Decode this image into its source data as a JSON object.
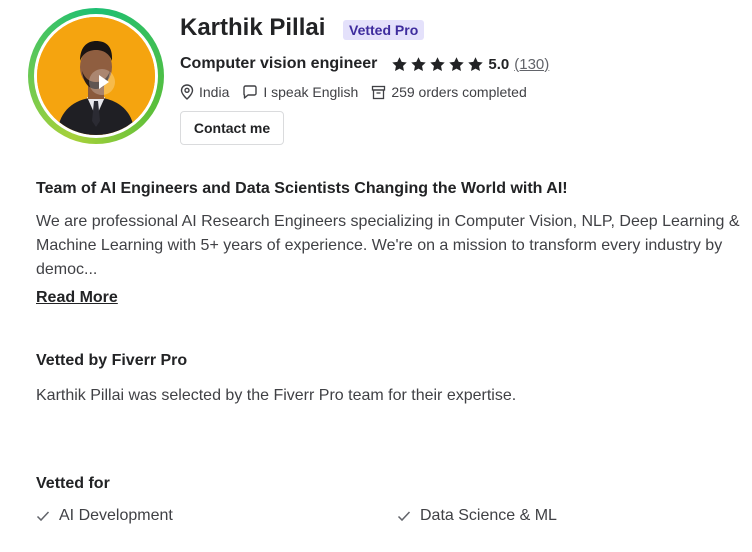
{
  "profile": {
    "name": "Karthik Pillai",
    "badge": "Vetted Pro",
    "job_title": "Computer vision engineer",
    "rating": "5.0",
    "stars": 5,
    "review_count": "(130)",
    "location": "India",
    "language": "I speak English",
    "orders": "259 orders completed",
    "contact_label": "Contact me"
  },
  "about": {
    "headline": "Team of AI Engineers and Data Scientists Changing the World with AI!",
    "description": "We are professional AI Research Engineers specializing in Computer Vision, NLP, Deep Learning & Machine Learning with 5+ years of experience. We're on a mission to transform every industry by democ...",
    "read_more": "Read More"
  },
  "vetted": {
    "title": "Vetted by Fiverr Pro",
    "description": "Karthik Pillai was selected by the Fiverr Pro team for their expertise.",
    "for_title": "Vetted for",
    "skills": [
      "AI Development",
      "Data Science & ML"
    ]
  },
  "colors": {
    "accent_green": "#1dbf73",
    "badge_bg": "#e4e1fb",
    "badge_text": "#3e2c9d",
    "avatar_bg": "#f5a40f"
  },
  "icons": [
    "play-icon",
    "star-icon",
    "location-pin-icon",
    "speech-bubble-icon",
    "orders-box-icon",
    "checkmark-icon"
  ]
}
